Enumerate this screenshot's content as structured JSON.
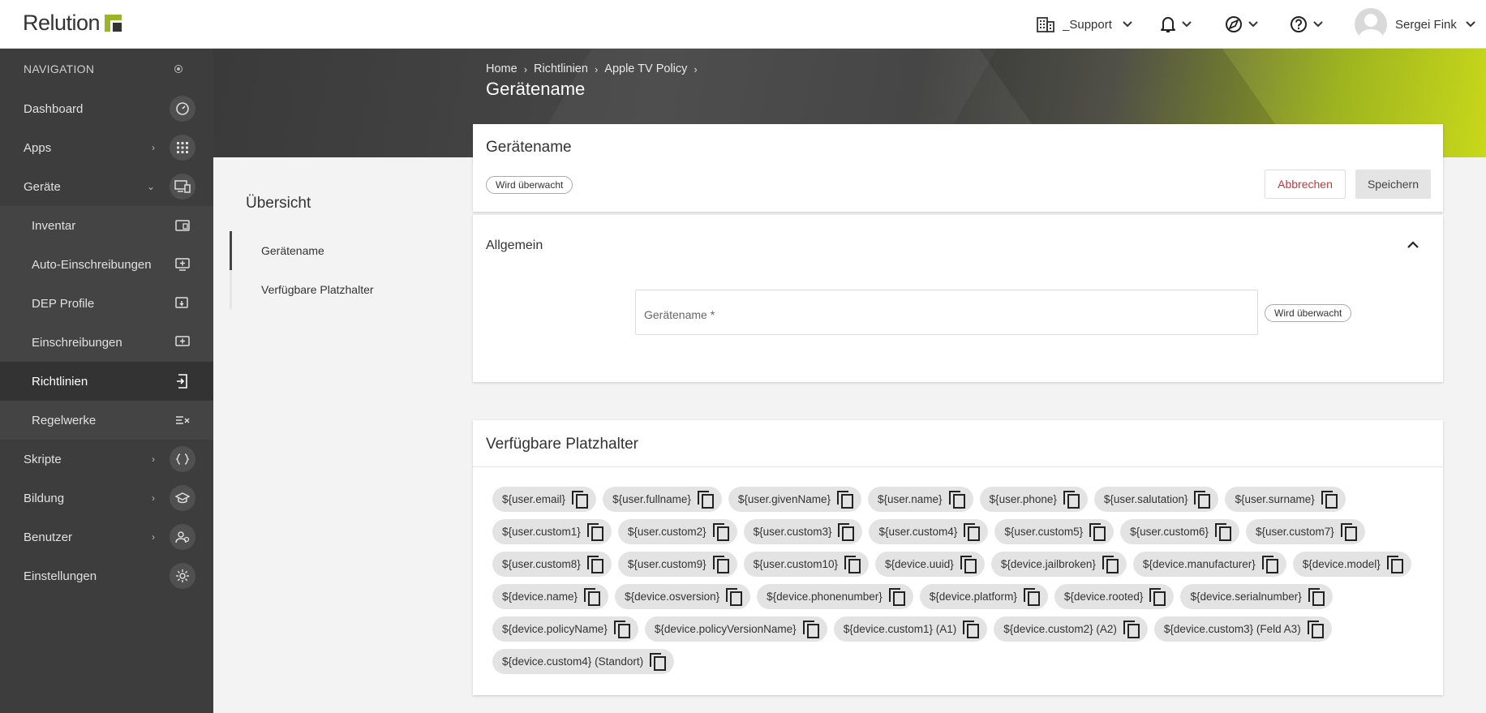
{
  "app": {
    "logo_text": "Relution"
  },
  "topbar": {
    "org_name": "_Support",
    "user_name": "Sergei Fink"
  },
  "sidebar": {
    "heading": "NAVIGATION",
    "items": [
      {
        "label": "Dashboard",
        "icon": "gauge-icon"
      },
      {
        "label": "Apps",
        "icon": "grid-icon"
      },
      {
        "label": "Geräte",
        "icon": "devices-icon"
      },
      {
        "label": "Inventar",
        "icon": "inventory-icon"
      },
      {
        "label": "Auto-Einschreibungen",
        "icon": "auto-enroll-icon"
      },
      {
        "label": "DEP Profile",
        "icon": "dep-profile-icon"
      },
      {
        "label": "Einschreibungen",
        "icon": "enrollment-icon"
      },
      {
        "label": "Richtlinien",
        "icon": "policy-icon"
      },
      {
        "label": "Regelwerke",
        "icon": "rules-icon"
      },
      {
        "label": "Skripte",
        "icon": "code-icon"
      },
      {
        "label": "Bildung",
        "icon": "education-icon"
      },
      {
        "label": "Benutzer",
        "icon": "users-icon"
      },
      {
        "label": "Einstellungen",
        "icon": "gear-icon"
      }
    ]
  },
  "breadcrumb": [
    "Home",
    "Richtlinien",
    "Apple TV Policy"
  ],
  "page_title": "Gerätename",
  "overview": {
    "title": "Übersicht",
    "items": [
      "Gerätename",
      "Verfügbare Platzhalter"
    ]
  },
  "config_card": {
    "title": "Gerätename",
    "monitored_badge": "Wird überwacht",
    "cancel_label": "Abbrechen",
    "save_label": "Speichern"
  },
  "general_section": {
    "title": "Allgemein",
    "field_placeholder": "Gerätename *",
    "field_badge": "Wird überwacht"
  },
  "placeholders_card": {
    "title": "Verfügbare Platzhalter",
    "chips": [
      "${user.email}",
      "${user.fullname}",
      "${user.givenName}",
      "${user.name}",
      "${user.phone}",
      "${user.salutation}",
      "${user.surname}",
      "${user.custom1}",
      "${user.custom2}",
      "${user.custom3}",
      "${user.custom4}",
      "${user.custom5}",
      "${user.custom6}",
      "${user.custom7}",
      "${user.custom8}",
      "${user.custom9}",
      "${user.custom10}",
      "${device.uuid}",
      "${device.jailbroken}",
      "${device.manufacturer}",
      "${device.model}",
      "${device.name}",
      "${device.osversion}",
      "${device.phonenumber}",
      "${device.platform}",
      "${device.rooted}",
      "${device.serialnumber}",
      "${device.policyName}",
      "${device.policyVersionName}",
      "${device.custom1} (A1)",
      "${device.custom2} (A2)",
      "${device.custom3} (Feld A3)",
      "${device.custom4} (Standort)"
    ]
  },
  "colors": {
    "accent": "#9ab526",
    "cancel": "#c0393b",
    "sidebar": "#3d3d3d"
  }
}
